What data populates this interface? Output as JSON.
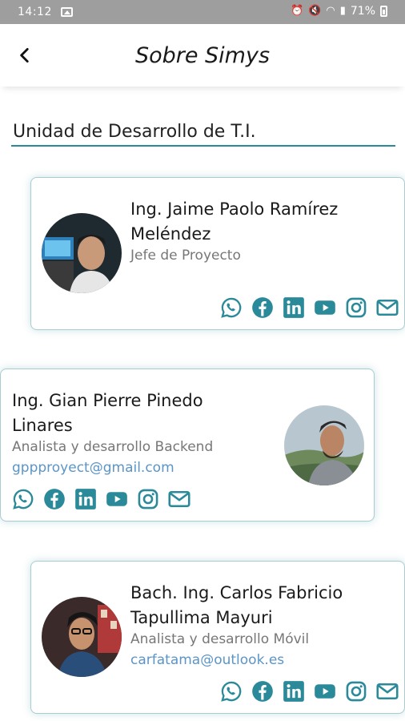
{
  "status_bar": {
    "time": "14:12",
    "battery": "71%",
    "icons": [
      "image-icon",
      "alarm-icon",
      "mute-icon",
      "wifi-icon",
      "signal-icon",
      "battery-icon"
    ]
  },
  "header": {
    "title": "Sobre Simys",
    "back_icon": "chevron-left-icon"
  },
  "section": {
    "title": "Unidad de Desarrollo de T.I."
  },
  "colors": {
    "accent": "#2b8a99",
    "link": "#5b95c8",
    "role_text": "#777777",
    "status_bar": "#9e9e9e"
  },
  "team": [
    {
      "name_line1": "Ing. Jaime Paolo Ramírez",
      "name_line2": "Meléndez",
      "role": "Jefe de Proyecto",
      "email": ""
    },
    {
      "name_line1": "Ing. Gian Pierre Pinedo",
      "name_line2": "Linares",
      "role": "Analista y desarrollo Backend",
      "email": "gppproyect@gmail.com"
    },
    {
      "name_line1": "Bach. Ing. Carlos Fabricio",
      "name_line2": "Tapullima Mayuri",
      "role": "Analista y desarrollo Móvil",
      "email": "carfatama@outlook.es"
    }
  ],
  "social_icons": [
    "whatsapp-icon",
    "facebook-icon",
    "linkedin-icon",
    "youtube-icon",
    "instagram-icon",
    "mail-icon"
  ]
}
